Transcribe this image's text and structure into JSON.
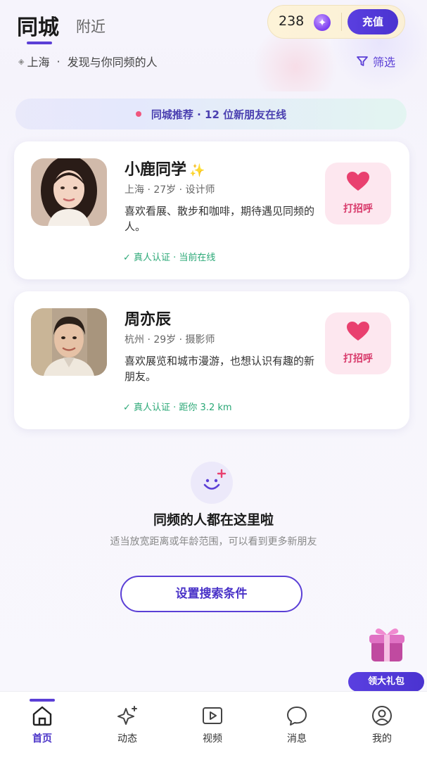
{
  "header": {
    "tab_active": "同城",
    "tab_inactive": "附近",
    "coin_count": "238",
    "recharge_label": "充值",
    "location": "上海",
    "separator": "·",
    "slogan": "发现与你同频的人",
    "filter_label": "筛选"
  },
  "banner": {
    "text": "同城推荐 · 12 位新朋友在线"
  },
  "cards": [
    {
      "name": "小鹿同学",
      "meta": "上海 · 27岁 · 设计师",
      "bio": "喜欢看展、散步和咖啡，期待遇见同频的人。",
      "verify": "✓ 真人认证 · 当前在线",
      "greet_label": "打招呼"
    },
    {
      "name": "周亦辰",
      "meta": "杭州 · 29岁 · 摄影师",
      "bio": "喜欢展览和城市漫游，也想认识有趣的新朋友。",
      "verify": "✓ 真人认证 · 距你 3.2 km",
      "greet_label": "打招呼"
    }
  ],
  "empty_state": {
    "title": "同频的人都在这里啦",
    "subtitle": "适当放宽距离或年龄范围，可以看到更多新朋友",
    "button_label": "设置搜索条件"
  },
  "gift": {
    "label": "领大礼包"
  },
  "bottom_nav": {
    "items": [
      {
        "label": "首页",
        "icon": "home-icon",
        "active": true
      },
      {
        "label": "动态",
        "icon": "sparkle-icon",
        "active": false
      },
      {
        "label": "视频",
        "icon": "video-icon",
        "active": false
      },
      {
        "label": "消息",
        "icon": "message-icon",
        "active": false
      },
      {
        "label": "我的",
        "icon": "profile-icon",
        "active": false
      }
    ]
  },
  "colors": {
    "accent": "#5b3fd6",
    "heart": "#e9406f",
    "verify": "#2aa876"
  }
}
